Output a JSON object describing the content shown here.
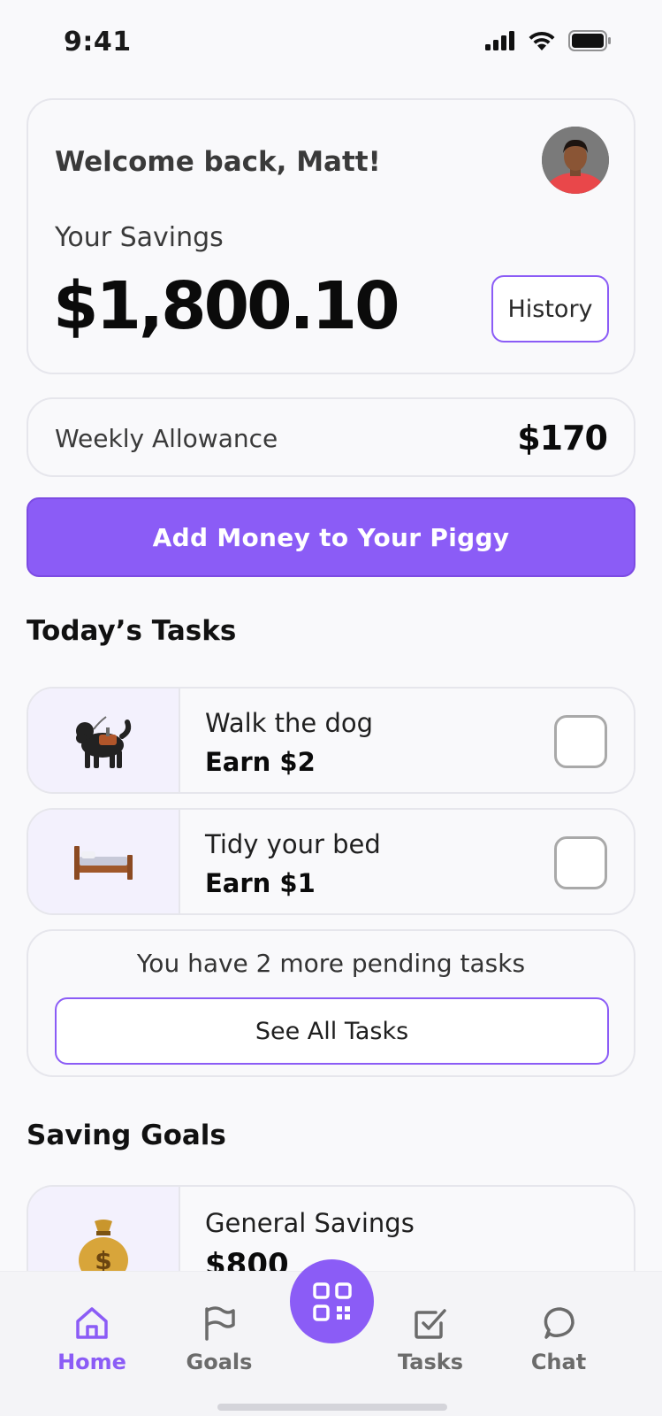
{
  "status_bar": {
    "time": "9:41"
  },
  "savings": {
    "welcome": "Welcome back, Matt!",
    "label": "Your Savings",
    "amount": "$1,800.10",
    "history_label": "History"
  },
  "allowance": {
    "label": "Weekly Allowance",
    "value": "$170"
  },
  "add_money_label": "Add Money to Your Piggy",
  "tasks_section": {
    "title": "Today’s Tasks",
    "items": [
      {
        "title": "Walk the dog",
        "earn": "Earn $2",
        "icon": "dog-icon"
      },
      {
        "title": "Tidy your bed",
        "earn": "Earn $1",
        "icon": "bed-icon"
      }
    ],
    "pending_text": "You have 2 more pending tasks",
    "see_all_label": "See All Tasks"
  },
  "goals_section": {
    "title": "Saving Goals",
    "items": [
      {
        "title": "General Savings",
        "amount": "$800",
        "icon": "money-bag-icon"
      }
    ]
  },
  "nav": {
    "items": [
      {
        "label": "Home",
        "icon": "home-icon",
        "active": true
      },
      {
        "label": "Goals",
        "icon": "flag-icon",
        "active": false
      },
      {
        "label": "Tasks",
        "icon": "checkbox-icon",
        "active": false
      },
      {
        "label": "Chat",
        "icon": "chat-icon",
        "active": false
      }
    ],
    "center_icon": "qr-code-icon"
  },
  "colors": {
    "accent": "#8b5cf6",
    "background": "#f9f9fb",
    "card_border": "#e6e6ec"
  }
}
